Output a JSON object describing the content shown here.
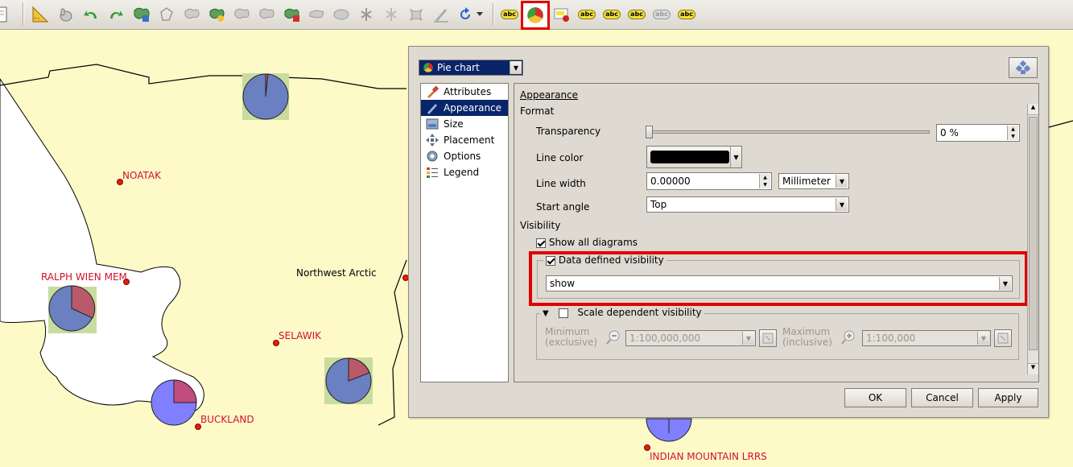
{
  "toolbar": {
    "icons": [
      "document-icon",
      "ruler-icon",
      "pan-icon",
      "undo-icon",
      "redo-icon",
      "layer-tool-icon",
      "tool-icon",
      "tool-icon",
      "tool-icon",
      "tool-icon",
      "tool-icon",
      "tool-icon",
      "tool-icon",
      "tool-icon",
      "tool-icon",
      "tool-icon",
      "tool-icon",
      "tool-icon",
      "tool-icon",
      "refresh-icon",
      "label-abc-icon",
      "pie-diagram-icon",
      "label-tool-icon",
      "label-tool-icon",
      "label-tool-icon",
      "label-tool-icon",
      "label-tool-icon",
      "label-tool-icon"
    ],
    "abc_text": "abc"
  },
  "map": {
    "labels": [
      {
        "text": "NOATAK",
        "type": "place"
      },
      {
        "text": "RALPH WIEN MEM",
        "type": "place"
      },
      {
        "text": "Northwest Arctic",
        "type": "region"
      },
      {
        "text": "SELAWIK",
        "type": "place"
      },
      {
        "text": "BUCKLAND",
        "type": "place"
      },
      {
        "text": "INDIAN MOUNTAIN LRRS",
        "type": "place"
      }
    ],
    "colors": {
      "land": "#fdfac8",
      "water": "#ffffff",
      "pie_blue": "#6b80c0",
      "pie_red": "#b85a6a",
      "pie_purple": "#7f7fff",
      "pie_pink": "#c04c80",
      "halo": "#c8dca0",
      "point": "#e02000"
    }
  },
  "dialog": {
    "renderer": "Pie chart",
    "sidebar": [
      {
        "label": "Attributes",
        "icon": "paint-brush-icon"
      },
      {
        "label": "Appearance",
        "icon": "pen-icon",
        "active": true
      },
      {
        "label": "Size",
        "icon": "image-size-icon"
      },
      {
        "label": "Placement",
        "icon": "move-arrows-icon"
      },
      {
        "label": "Options",
        "icon": "options-gear-icon"
      },
      {
        "label": "Legend",
        "icon": "legend-icon"
      }
    ],
    "appearance_header": "Appearance",
    "format_header": "Format",
    "transparency_label": "Transparency",
    "transparency_value": "0 %",
    "line_color_label": "Line color",
    "line_color": "#000000",
    "line_width_label": "Line width",
    "line_width_value": "0.00000",
    "line_width_unit": "Millimeter",
    "start_angle_label": "Start angle",
    "start_angle_value": "Top",
    "visibility_header": "Visibility",
    "show_all_label": "Show all diagrams",
    "data_defined_label": "Data defined visibility",
    "data_defined_value": "show",
    "scale_dependent_label": "Scale dependent visibility",
    "minimum_label": "Minimum",
    "minimum_sub": "(exclusive)",
    "minimum_value": "1:100,000,000",
    "maximum_label": "Maximum",
    "maximum_sub": "(inclusive)",
    "maximum_value": "1:100,000",
    "ok_label": "OK",
    "cancel_label": "Cancel",
    "apply_label": "Apply",
    "highlight_color": "#e00000"
  }
}
